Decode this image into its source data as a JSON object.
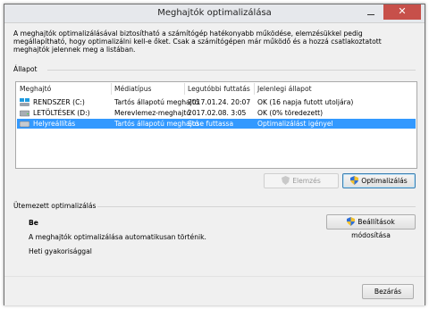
{
  "window": {
    "title": "Meghajtók optimalizálása",
    "close": "✕"
  },
  "description": "A meghajtók optimalizálásával biztosítható a számítógép hatékonyabb működése, elemzésükkel pedig megállapítható, hogy optimalizálni kell-e őket. Csak a számítógépen már működő és a hozzá csatlakoztatott meghajtók jelennek meg a listában.",
  "status": {
    "label": "Állapot",
    "columns": [
      "Meghajtó",
      "Médiatípus",
      "Legutóbbi futtatás",
      "Jelenlegi állapot"
    ],
    "rows": [
      {
        "drive": "RENDSZER (C:)",
        "media": "Tartós állapotú meghajtó",
        "last_run": "2017.01.24. 20:07",
        "state": "OK (16 napja futott utoljára)",
        "icon": "windows-drive-icon"
      },
      {
        "drive": "LETÖLTÉSEK (D:)",
        "media": "Merevlemez-meghajtó",
        "last_run": "2017.02.08. 3:05",
        "state": "OK (0% töredezett)",
        "icon": "hard-drive-icon"
      },
      {
        "drive": "Helyreállítás",
        "media": "Tartós állapotú meghajtó",
        "last_run": "Sose futtassa",
        "state": "Optimalizálást igényel",
        "icon": "hard-drive-icon",
        "selected": true
      }
    ]
  },
  "buttons": {
    "analyze": "Elemzés",
    "optimize": "Optimalizálás",
    "change_settings": "Beállítások módosítása",
    "close": "Bezárás"
  },
  "schedule": {
    "label": "Ütemezett optimalizálás",
    "state": "Be",
    "detail": "A meghajtók optimalizálása automatikusan történik.",
    "frequency": "Heti gyakorisággal"
  }
}
